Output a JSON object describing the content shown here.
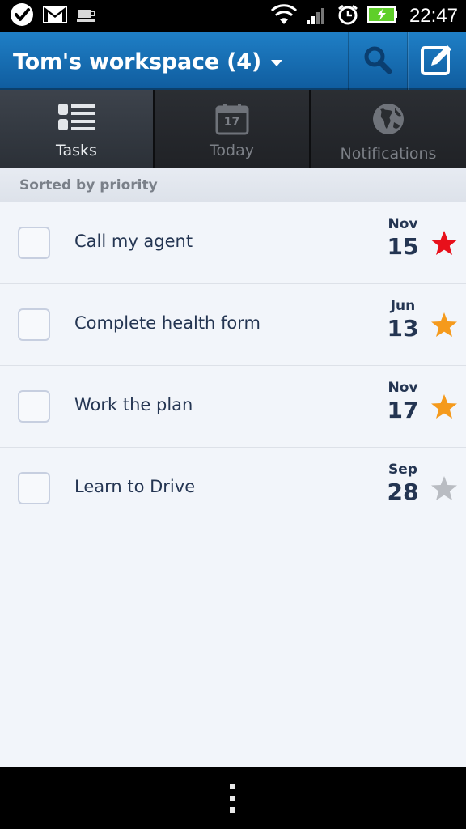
{
  "status_bar": {
    "time": "22:47",
    "icons": [
      "check-icon",
      "gmail-icon",
      "coffee-icon",
      "wifi-icon",
      "signal-icon",
      "alarm-icon",
      "battery-charging-icon"
    ]
  },
  "app_bar": {
    "title": "Tom's workspace (4)",
    "actions": [
      "search-icon",
      "compose-icon"
    ]
  },
  "tabs": [
    {
      "label": "Tasks",
      "icon": "task-list-icon",
      "active": true
    },
    {
      "label": "Today",
      "icon": "calendar-icon",
      "calendar_day": "17",
      "active": false
    },
    {
      "label": "Notifications",
      "icon": "globe-icon",
      "active": false
    }
  ],
  "sort_label": "Sorted by priority",
  "tasks": [
    {
      "title": "Call my agent",
      "month": "Nov",
      "day": "15",
      "star": "red",
      "checked": false
    },
    {
      "title": "Complete health form",
      "month": "Jun",
      "day": "13",
      "star": "orange",
      "checked": false
    },
    {
      "title": "Work the plan",
      "month": "Nov",
      "day": "17",
      "star": "orange",
      "checked": false
    },
    {
      "title": "Learn to Drive",
      "month": "Sep",
      "day": "28",
      "star": "gray",
      "checked": false
    }
  ],
  "colors": {
    "app_bar": "#1a72b8",
    "star_red": "#e8101b",
    "star_orange": "#f59a1c",
    "star_gray": "#b9bcc2",
    "text_primary": "#243552"
  },
  "nav_bar": {
    "icons": [
      "menu-overflow-icon"
    ]
  }
}
